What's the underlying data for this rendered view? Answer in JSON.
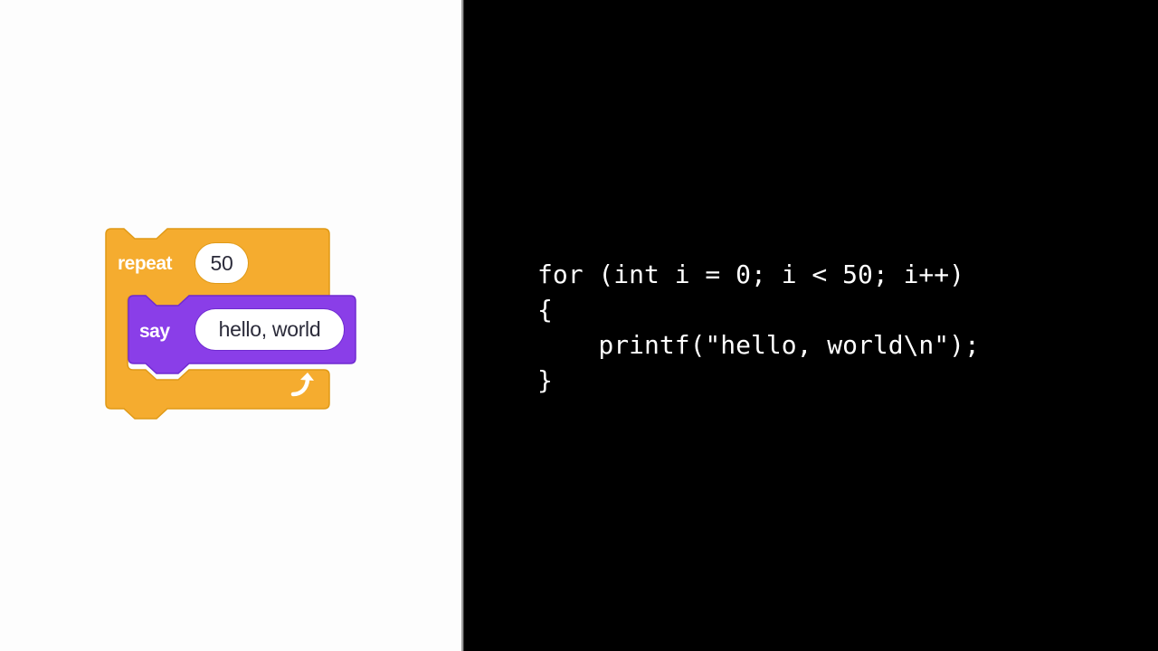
{
  "scratch": {
    "repeat_label": "repeat",
    "repeat_count": "50",
    "say_label": "say",
    "say_text": "hello, world",
    "loop_arrow_icon": "loop-arrow-icon",
    "colors": {
      "control_block": "#f5ac2f",
      "control_block_edge": "#e09a17",
      "looks_block": "#8a3ee8",
      "looks_block_edge": "#6f2bd0",
      "left_background": "#fdfdfd",
      "right_background": "#000000"
    }
  },
  "code": {
    "lines": [
      "for (int i = 0; i < 50; i++)",
      "{",
      "    printf(\"hello, world\\n\");",
      "}"
    ]
  }
}
